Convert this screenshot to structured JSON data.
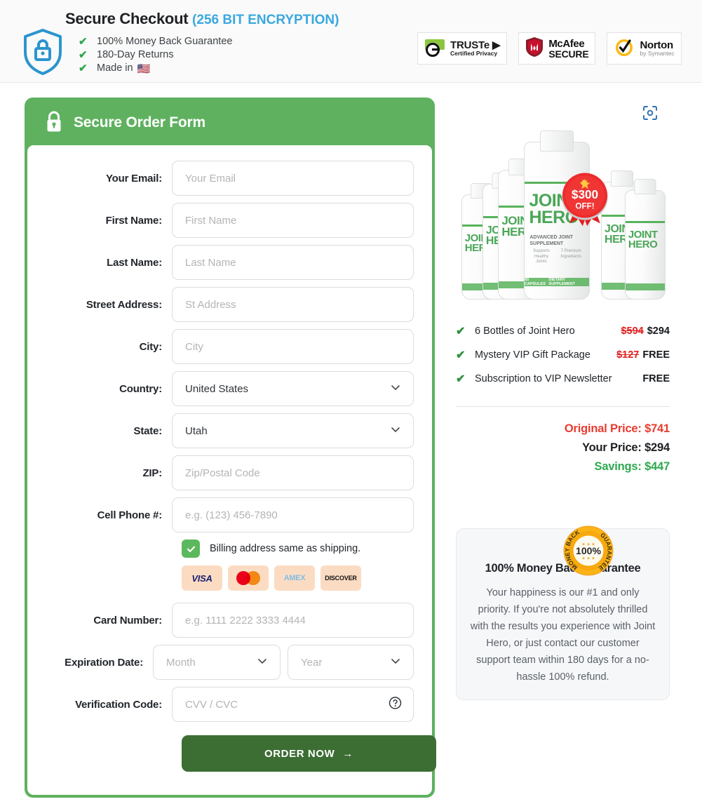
{
  "header": {
    "shield_icon": "shield-lock-icon",
    "title": "Secure Checkout",
    "encryption": "(256 BIT ENCRYPTION)",
    "benefits": [
      {
        "check": "✔",
        "text": "100% Money Back Guarantee"
      },
      {
        "check": "✔",
        "text": "180-Day Returns"
      },
      {
        "check": "✔",
        "text": "Made in",
        "flag": "🇺🇸"
      }
    ],
    "badges": [
      {
        "name": "truste-badge",
        "line1": "TRUSTe ▶",
        "line2": "Certified Privacy"
      },
      {
        "name": "mcafee-badge",
        "line1": "McAfee",
        "line2": "SECURE"
      },
      {
        "name": "norton-badge",
        "line1": "Norton",
        "line2": "by Symantec"
      }
    ]
  },
  "form": {
    "lock_icon": "lock-icon",
    "heading": "Secure Order Form",
    "fields": [
      {
        "label": "Your Email:",
        "placeholder": "Your Email",
        "value": "",
        "type": "text"
      },
      {
        "label": "First Name:",
        "placeholder": "First Name",
        "value": "",
        "type": "text"
      },
      {
        "label": "Last Name:",
        "placeholder": "Last Name",
        "value": "",
        "type": "text"
      },
      {
        "label": "Street Address:",
        "placeholder": "St Address",
        "value": "",
        "type": "text"
      },
      {
        "label": "City:",
        "placeholder": "City",
        "value": "",
        "type": "text"
      },
      {
        "label": "Country:",
        "placeholder": "",
        "value": "United States",
        "type": "select"
      },
      {
        "label": "State:",
        "placeholder": "",
        "value": "Utah",
        "type": "select"
      },
      {
        "label": "ZIP:",
        "placeholder": "Zip/Postal Code",
        "value": "",
        "type": "text"
      },
      {
        "label": "Cell Phone #:",
        "placeholder": "e.g. (123) 456-7890",
        "value": "",
        "type": "text"
      }
    ],
    "billing_checkbox": {
      "checked": true,
      "label": "Billing address same as shipping."
    },
    "card_logos": [
      "VISA",
      "mastercard",
      "AMEX",
      "DISCOVER"
    ],
    "card_number": {
      "label": "Card Number:",
      "placeholder": "e.g. 1111 2222 3333 4444",
      "value": ""
    },
    "expiration": {
      "label": "Expiration Date:",
      "month_placeholder": "Month",
      "month_value": "",
      "year_placeholder": "Year",
      "year_value": ""
    },
    "verification": {
      "label": "Verification Code:",
      "placeholder": "CVV / CVC",
      "value": "",
      "help_icon": "question-circle-icon"
    },
    "submit_label": "ORDER NOW",
    "submit_arrow": "→"
  },
  "product": {
    "scan_icon": "scan-zoom-icon",
    "brand_line1": "JOINT",
    "brand_line2": "HERO",
    "tagline": "ADVANCED JOINT SUPPLEMENT",
    "sub_left": "Supports Healthy Joints",
    "sub_right": "7 Premium Ingredients",
    "footer_left": "60 CAPSULES",
    "footer_right": "DIETARY SUPPLEMENT",
    "discount_amount": "$300",
    "discount_word": "OFF!"
  },
  "summary": {
    "items": [
      {
        "check": "✔",
        "name": "6 Bottles of Joint Hero",
        "old_price": "$594",
        "price": "$294"
      },
      {
        "check": "✔",
        "name": "Mystery VIP Gift Package",
        "old_price": "$127",
        "price": "FREE"
      },
      {
        "check": "✔",
        "name": "Subscription to VIP Newsletter",
        "old_price": "",
        "price": "FREE"
      }
    ],
    "original_price_label": "Original Price: $741",
    "your_price_label": "Your Price: $294",
    "savings_label": "Savings: $447"
  },
  "guarantee": {
    "seal_top": "MONEY BACK",
    "seal_center": "100%",
    "seal_bottom": "GUARANTEE",
    "title": "100% Money Back Guarantee",
    "text": "Your happiness is our #1 and only priority. If you're not absolutely thrilled with the results you experience with Joint Hero, or just contact our customer support team within 180 days for a no-hassle 100% refund."
  },
  "colors": {
    "brand_green": "#5fb15f",
    "button_green": "#3c6e33",
    "accent_blue": "#3aa8e0",
    "price_red": "#ea3b2f",
    "savings_green": "#2fa84f"
  }
}
